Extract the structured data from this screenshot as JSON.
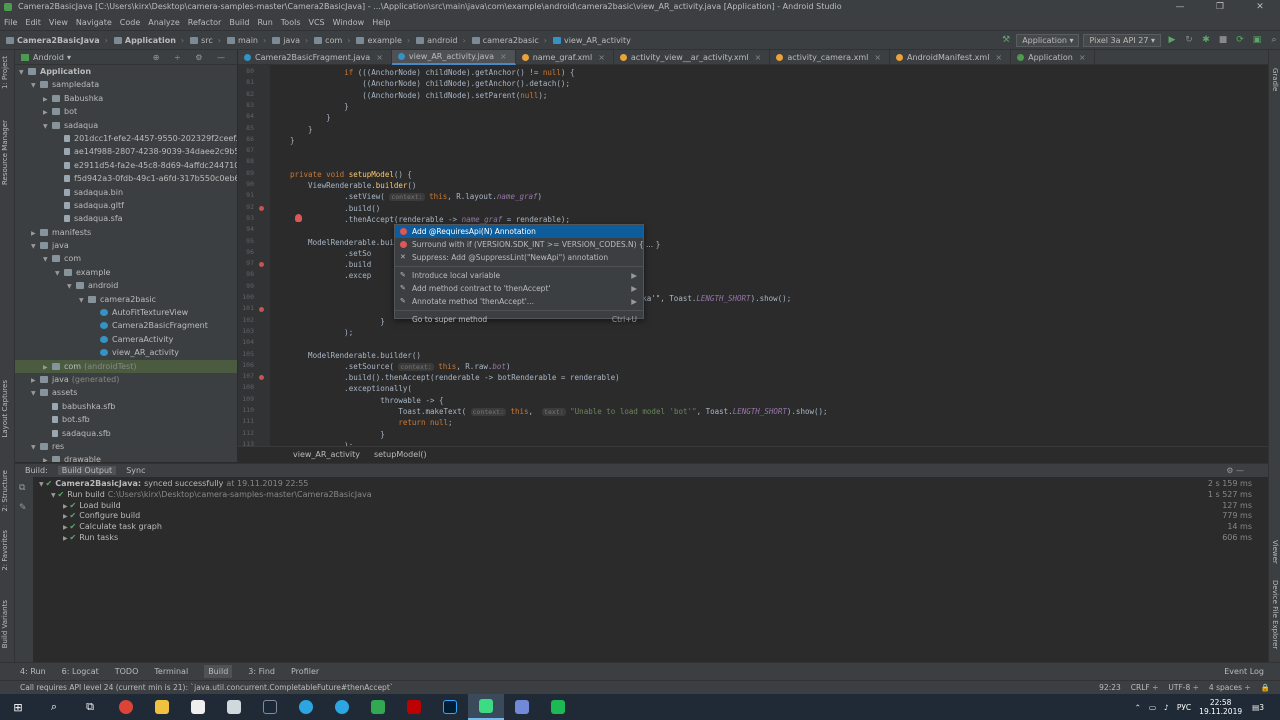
{
  "window": {
    "title": "Camera2BasicJava [C:\\Users\\kirx\\Desktop\\camera-samples-master\\Camera2BasicJava] - ...\\Application\\src\\main\\java\\com\\example\\android\\camera2basic\\view_AR_activity.java [Application] - Android Studio",
    "min": "—",
    "max": "❐",
    "close": "✕"
  },
  "menu": [
    "File",
    "Edit",
    "View",
    "Navigate",
    "Code",
    "Analyze",
    "Refactor",
    "Build",
    "Run",
    "Tools",
    "VCS",
    "Window",
    "Help"
  ],
  "breadcrumbs": [
    "Camera2BasicJava",
    "Application",
    "src",
    "main",
    "java",
    "com",
    "example",
    "android",
    "camera2basic",
    "view_AR_activity"
  ],
  "runconfig": {
    "module": "Application",
    "device": "Pixel 3a API 27"
  },
  "left_tabs": [
    "1: Project",
    "Resource Manager",
    "Layout Captures",
    "2: Structure",
    "2: Favorites",
    "Build Variants"
  ],
  "right_tabs": [
    "Gradle",
    "Viewer",
    "Device File Explorer"
  ],
  "project": {
    "view": "Android",
    "tree": [
      {
        "d": 0,
        "a": "▼",
        "t": "fold",
        "n": "Application",
        "bold": true
      },
      {
        "d": 1,
        "a": "▼",
        "t": "fold",
        "n": "sampledata"
      },
      {
        "d": 2,
        "a": "▶",
        "t": "fold",
        "n": "Babushka"
      },
      {
        "d": 2,
        "a": "▶",
        "t": "fold",
        "n": "bot"
      },
      {
        "d": 2,
        "a": "▼",
        "t": "fold",
        "n": "sadaqua"
      },
      {
        "d": 3,
        "a": "",
        "t": "file",
        "n": "201dcc1f-efe2-4457-9550-202329f2ceef.png"
      },
      {
        "d": 3,
        "a": "",
        "t": "file",
        "n": "ae14f988-2807-4238-9039-34daee2c9b5f.png"
      },
      {
        "d": 3,
        "a": "",
        "t": "file",
        "n": "e2911d54-fa2e-45c8-8d69-4affdc244710.png"
      },
      {
        "d": 3,
        "a": "",
        "t": "file",
        "n": "f5d942a3-0fdb-49c1-a6fd-317b550c0eb6.png"
      },
      {
        "d": 3,
        "a": "",
        "t": "file",
        "n": "sadaqua.bin"
      },
      {
        "d": 3,
        "a": "",
        "t": "file",
        "n": "sadaqua.gltf"
      },
      {
        "d": 3,
        "a": "",
        "t": "file",
        "n": "sadaqua.sfa"
      },
      {
        "d": 1,
        "a": "▶",
        "t": "fold",
        "n": "manifests"
      },
      {
        "d": 1,
        "a": "▼",
        "t": "fold",
        "n": "java"
      },
      {
        "d": 2,
        "a": "▼",
        "t": "fold",
        "n": "com"
      },
      {
        "d": 3,
        "a": "▼",
        "t": "fold",
        "n": "example"
      },
      {
        "d": 4,
        "a": "▼",
        "t": "fold",
        "n": "android"
      },
      {
        "d": 5,
        "a": "▼",
        "t": "fold",
        "n": "camera2basic"
      },
      {
        "d": 6,
        "a": "",
        "t": "cls",
        "n": "AutoFitTextureView"
      },
      {
        "d": 6,
        "a": "",
        "t": "cls",
        "n": "Camera2BasicFragment"
      },
      {
        "d": 6,
        "a": "",
        "t": "cls",
        "n": "CameraActivity"
      },
      {
        "d": 6,
        "a": "",
        "t": "cls",
        "n": "view_AR_activity"
      },
      {
        "d": 2,
        "a": "▶",
        "t": "fold",
        "n": "com",
        "extra": "(androidTest)",
        "hl": true
      },
      {
        "d": 1,
        "a": "▶",
        "t": "fold",
        "n": "java",
        "extra": "(generated)"
      },
      {
        "d": 1,
        "a": "▼",
        "t": "fold",
        "n": "assets"
      },
      {
        "d": 2,
        "a": "",
        "t": "file",
        "n": "babushka.sfb"
      },
      {
        "d": 2,
        "a": "",
        "t": "file",
        "n": "bot.sfb"
      },
      {
        "d": 2,
        "a": "",
        "t": "file",
        "n": "sadaqua.sfb"
      },
      {
        "d": 1,
        "a": "▼",
        "t": "fold",
        "n": "res"
      },
      {
        "d": 2,
        "a": "▶",
        "t": "fold",
        "n": "drawable"
      }
    ]
  },
  "tabs": [
    {
      "label": "Camera2BasicFragment.java",
      "color": "#3592c4",
      "active": false
    },
    {
      "label": "view_AR_activity.java",
      "color": "#3592c4",
      "active": true
    },
    {
      "label": "name_graf.xml",
      "color": "#e8a33d",
      "active": false
    },
    {
      "label": "activity_view__ar_activity.xml",
      "color": "#e8a33d",
      "active": false
    },
    {
      "label": "activity_camera.xml",
      "color": "#e8a33d",
      "active": false
    },
    {
      "label": "AndroidManifest.xml",
      "color": "#e8a33d",
      "active": false
    },
    {
      "label": "Application",
      "color": "#4e9a4e",
      "active": false
    }
  ],
  "code": [
    {
      "n": "80",
      "h": "            <span class=\"kw\">if</span> (((AnchorNode) childNode).getAnchor() != <span class=\"kw\">null</span>) {"
    },
    {
      "n": "81",
      "h": "                ((AnchorNode) childNode).getAnchor().detach();"
    },
    {
      "n": "82",
      "h": "                ((AnchorNode) childNode).setParent(<span class=\"kw\">null</span>);"
    },
    {
      "n": "83",
      "h": "            }"
    },
    {
      "n": "84",
      "h": "        }"
    },
    {
      "n": "85",
      "h": "    }"
    },
    {
      "n": "86",
      "h": "}"
    },
    {
      "n": "87",
      "h": ""
    },
    {
      "n": "88",
      "h": ""
    },
    {
      "n": "89",
      "h": "<span class=\"kw\">private void</span> <span class=\"fn\">setupModel</span>() {"
    },
    {
      "n": "90",
      "h": "    ViewRenderable.<span class=\"fn\">builder</span>()"
    },
    {
      "n": "91",
      "h": "            .setView( <span class=\"hint\">context:</span> <span class=\"kw\">this</span>, R.layout.<span class=\"fld\">name_graf</span>)"
    },
    {
      "n": "92",
      "h": "            .build()"
    },
    {
      "n": "93",
      "h": "            .thenAccept(renderable -&gt; <span class=\"fld\">name_graf</span> = renderable);"
    },
    {
      "n": "94",
      "h": ""
    },
    {
      "n": "95",
      "h": "    ModelRenderable.builder()"
    },
    {
      "n": "96",
      "h": "            .setSo"
    },
    {
      "n": "97",
      "h": "            .build                                                    rable)"
    },
    {
      "n": "98",
      "h": "            .excep"
    },
    {
      "n": "99",
      "h": ""
    },
    {
      "n": "100",
      "h": "                                                              ad model 'Babushka'\", Toast.<span class=\"fld\">LENGTH_SHORT</span>).show();"
    },
    {
      "n": "101",
      "h": ""
    },
    {
      "n": "102",
      "h": "                    }"
    },
    {
      "n": "103",
      "h": "            );"
    },
    {
      "n": "104",
      "h": ""
    },
    {
      "n": "105",
      "h": "    ModelRenderable.builder()"
    },
    {
      "n": "106",
      "h": "            .setSource( <span class=\"hint\">context:</span> <span class=\"kw\">this</span>, R.raw.<span class=\"fld\">bot</span>)"
    },
    {
      "n": "107",
      "h": "            .build().thenAccept(renderable -&gt; botRenderable = renderable)"
    },
    {
      "n": "108",
      "h": "            .exceptionally("
    },
    {
      "n": "109",
      "h": "                    throwable -&gt; {"
    },
    {
      "n": "110",
      "h": "                        Toast.makeText( <span class=\"hint\">context:</span> <span class=\"kw\">this</span>,  <span class=\"hint\">text:</span> <span class=\"st\">\"Unable to load model 'bot'\"</span>, Toast.<span class=\"fld\">LENGTH_SHORT</span>).show();"
    },
    {
      "n": "111",
      "h": "                        <span class=\"kw\">return null</span>;"
    },
    {
      "n": "112",
      "h": "                    }"
    },
    {
      "n": "113",
      "h": "            );"
    }
  ],
  "editor_breadcrumb": [
    "view_AR_activity",
    "setupModel()"
  ],
  "popup": [
    {
      "label": "Add @RequiresApi(N) Annotation",
      "icon": "bulb-red",
      "selected": true
    },
    {
      "label": "Surround with if (VERSION.SDK_INT >= VERSION_CODES.N) { ... }",
      "icon": "bulb-red"
    },
    {
      "label": "Suppress: Add @SuppressLint(\"NewApi\") annotation",
      "icon": "x"
    },
    {
      "sep": true
    },
    {
      "label": "Introduce local variable",
      "icon": "pencil",
      "sub": "▶"
    },
    {
      "label": "Add method contract to 'thenAccept'",
      "icon": "pencil",
      "sub": "▶"
    },
    {
      "label": "Annotate method 'thenAccept'...",
      "icon": "pencil",
      "sub": "▶"
    },
    {
      "sep": true
    },
    {
      "label": "Go to super method",
      "shortcut": "Ctrl+U"
    }
  ],
  "build": {
    "tabs": [
      "Build:",
      "Build Output",
      "Sync"
    ],
    "rows": [
      {
        "d": 0,
        "label": "Camera2BasicJava:",
        "extra": "synced successfully",
        "time_label": "at 19.11.2019 22:55",
        "time": "2 s 159 ms"
      },
      {
        "d": 1,
        "label": "Run build",
        "extra": "C:\\Users\\kirx\\Desktop\\camera-samples-master\\Camera2BasicJava",
        "time": "1 s 527 ms"
      },
      {
        "d": 2,
        "label": "Load build",
        "time": "127 ms"
      },
      {
        "d": 2,
        "label": "Configure build",
        "time": "779 ms"
      },
      {
        "d": 2,
        "label": "Calculate task graph",
        "time": "14 ms"
      },
      {
        "d": 2,
        "label": "Run tasks",
        "time": "606 ms"
      }
    ]
  },
  "bottom_tools": [
    {
      "label": "4: Run"
    },
    {
      "label": "6: Logcat"
    },
    {
      "label": "TODO"
    },
    {
      "label": "Terminal"
    },
    {
      "label": "Build",
      "active": true
    },
    {
      "label": "3: Find"
    },
    {
      "label": "Profiler"
    }
  ],
  "event_log": "Event Log",
  "status": {
    "message": "Call requires API level 24 (current min is 21): `java.util.concurrent.CompletableFuture#thenAccept`",
    "pos": "92:23",
    "crlf": "CRLF ÷",
    "enc": "UTF-8 ÷",
    "indent": "4 spaces ÷"
  },
  "taskbar": {
    "lang": "РУС",
    "time": "22:58",
    "date": "19.11.2019",
    "notif": "3"
  }
}
